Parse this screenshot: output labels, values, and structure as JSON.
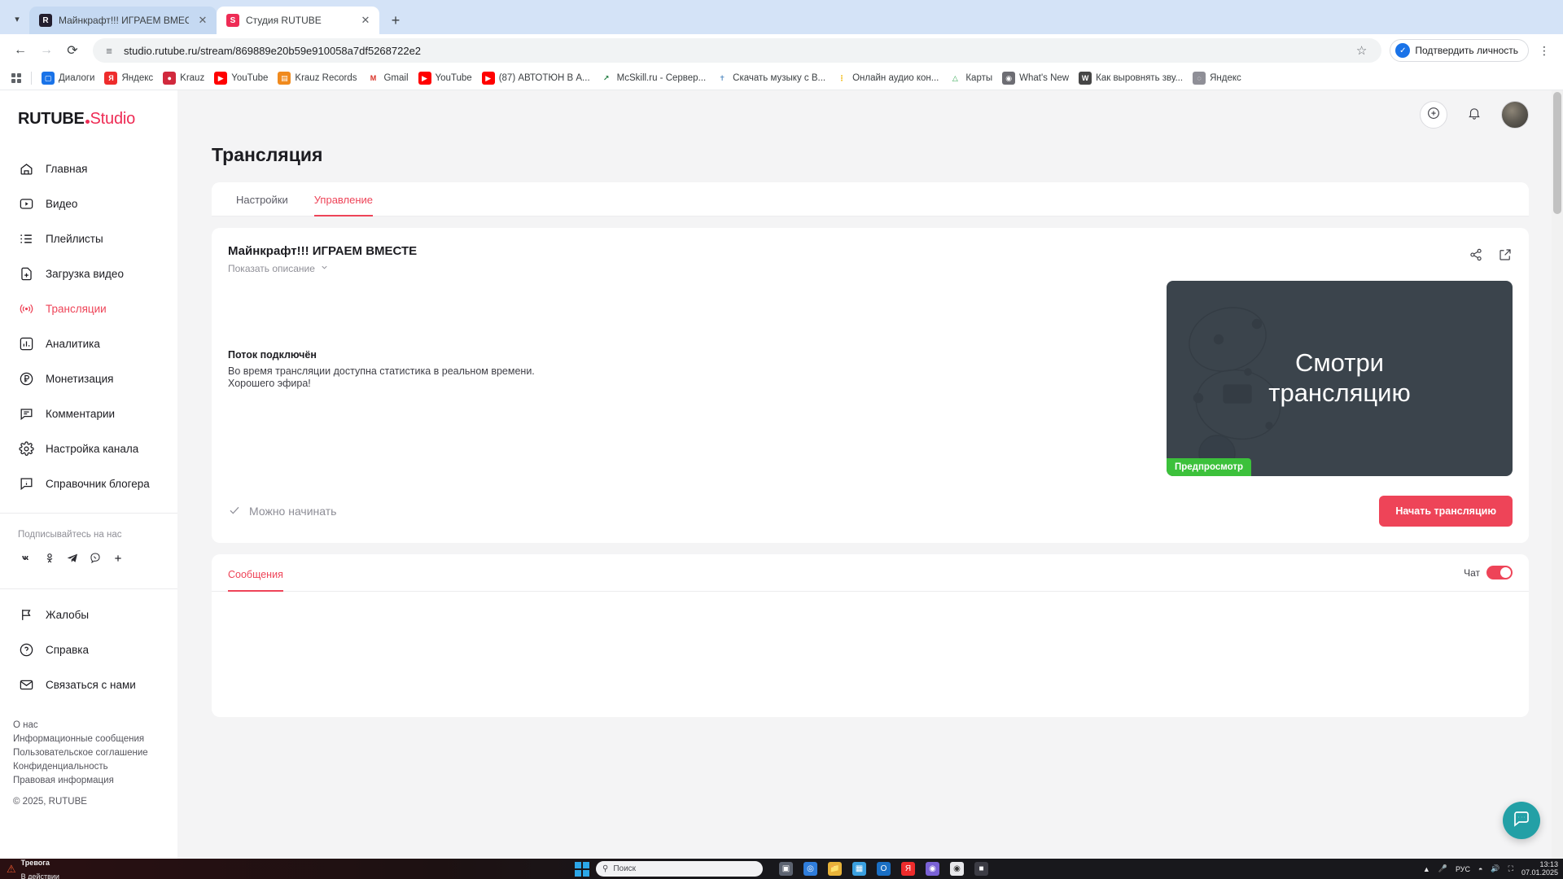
{
  "browser": {
    "tabs": [
      {
        "title": "Майнкрафт!!! ИГРАЕМ ВМЕСТЕ",
        "favicon": "rutube-dark-icon",
        "active": false
      },
      {
        "title": "Студия RUTUBE",
        "favicon": "rutube-red-icon",
        "active": true
      }
    ],
    "new_tab_label": "+",
    "url": "studio.rutube.ru/stream/869889e20b59e910058a7df5268722e2",
    "identity_button": "Подтвердить личность",
    "bookmarks": [
      {
        "label": "Диалоги",
        "color": "#1a73e8",
        "glyph": "◻"
      },
      {
        "label": "Яндекс",
        "color": "#ee2c2c",
        "glyph": "Я"
      },
      {
        "label": "Krauz",
        "color": "#d1293d",
        "glyph": "●"
      },
      {
        "label": "YouTube",
        "color": "#ff0000",
        "glyph": "▶"
      },
      {
        "label": "Krauz Records",
        "color": "#f08a1e",
        "glyph": "▥"
      },
      {
        "label": "Gmail",
        "color": "#ffffff",
        "glyph": "M"
      },
      {
        "label": "YouTube",
        "color": "#ff0000",
        "glyph": "▶"
      },
      {
        "label": "(87) АВТОТЮН В А...",
        "color": "#ff0000",
        "glyph": "▶"
      },
      {
        "label": "McSkill.ru - Сервер...",
        "color": "#ffffff",
        "glyph": "↗"
      },
      {
        "label": "Скачать музыку с В...",
        "color": "#ffffff",
        "glyph": "✇"
      },
      {
        "label": "Онлайн аудио кон...",
        "color": "#ffffff",
        "glyph": "⣿"
      },
      {
        "label": "Карты",
        "color": "#ffffff",
        "glyph": "▨"
      },
      {
        "label": "What's New",
        "color": "#6d6d73",
        "glyph": "◉"
      },
      {
        "label": "Как выровнять зву...",
        "color": "#464646",
        "glyph": "W"
      },
      {
        "label": "Яндекс",
        "color": "#8f8f97",
        "glyph": "◍"
      }
    ]
  },
  "sidebar": {
    "logo": {
      "rutube": "RUTUBE",
      "studio": "Studio"
    },
    "items": [
      {
        "label": "Главная",
        "icon": "home-icon",
        "active": false
      },
      {
        "label": "Видео",
        "icon": "video-icon",
        "active": false
      },
      {
        "label": "Плейлисты",
        "icon": "playlist-icon",
        "active": false
      },
      {
        "label": "Загрузка видео",
        "icon": "upload-icon",
        "active": false
      },
      {
        "label": "Трансляции",
        "icon": "broadcast-icon",
        "active": true
      },
      {
        "label": "Аналитика",
        "icon": "analytics-icon",
        "active": false
      },
      {
        "label": "Монетизация",
        "icon": "ruble-icon",
        "active": false
      },
      {
        "label": "Комментарии",
        "icon": "comment-icon",
        "active": false
      },
      {
        "label": "Настройка канала",
        "icon": "gear-icon",
        "active": false
      },
      {
        "label": "Справочник блогера",
        "icon": "info-icon",
        "active": false
      }
    ],
    "social_title": "Подписывайтесь на нас",
    "social": [
      "vk-icon",
      "ok-icon",
      "telegram-icon",
      "viber-icon",
      "plus-icon"
    ],
    "bottom_items": [
      {
        "label": "Жалобы",
        "icon": "flag-icon"
      },
      {
        "label": "Справка",
        "icon": "question-icon"
      },
      {
        "label": "Связаться с нами",
        "icon": "mail-icon"
      }
    ],
    "footer_links": [
      "О нас",
      "Информационные сообщения",
      "Пользовательское соглашение",
      "Конфиденциальность",
      "Правовая информация"
    ],
    "copyright": "© 2025, RUTUBE"
  },
  "topbar": {
    "add_button": "plus-circle-icon",
    "notifications_button": "bell-icon",
    "avatar": "avatar"
  },
  "main": {
    "page_title": "Трансляция",
    "tabs": [
      {
        "label": "Настройки",
        "active": false
      },
      {
        "label": "Управление",
        "active": true
      }
    ],
    "stream": {
      "title": "Майнкрафт!!! ИГРАЕМ ВМЕСТЕ",
      "show_description": "Показать описание",
      "share_icon": "share-icon",
      "open_icon": "external-link-icon",
      "status_heading": "Поток подключён",
      "status_line_1": "Во время трансляции доступна статистика в реальном времени.",
      "status_line_2": "Хорошего эфира!",
      "preview_line_1": "Смотри",
      "preview_line_2": "трансляцию",
      "preview_badge": "Предпросмотр",
      "ready_label": "Можно начинать",
      "start_button": "Начать трансляцию"
    },
    "chat": {
      "tab_label": "Сообщения",
      "toggle_label": "Чат",
      "toggle_on": true
    },
    "support_fab": "support-chat-icon"
  },
  "colors": {
    "accent": "#ee4458",
    "brand_red": "#ee2c55",
    "preview_badge": "#3cc13b",
    "fab": "#23a0a6"
  },
  "taskbar": {
    "alert_title": "Тревога",
    "alert_subtitle": "В действии",
    "search_placeholder": "Поиск",
    "language": "РУС",
    "time": "13:13",
    "date": "07.01.2025"
  }
}
